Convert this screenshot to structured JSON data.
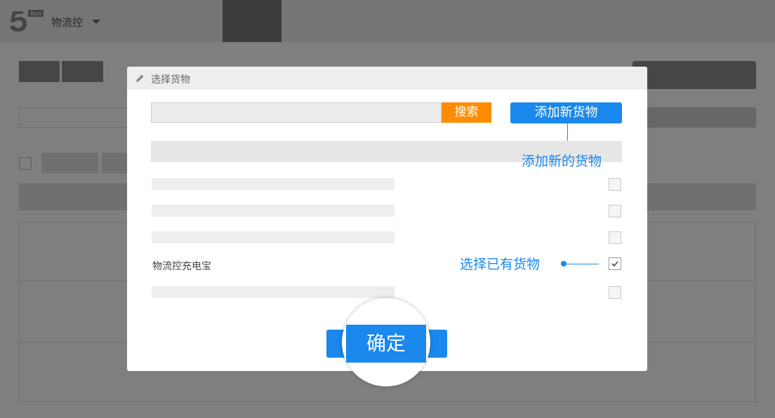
{
  "app": {
    "brand_name": "物流控",
    "logo_badge": "Kon"
  },
  "dialog": {
    "title": "选择货物",
    "search": {
      "placeholder": "",
      "value": "",
      "button_label": "搜索"
    },
    "add_button_label": "添加新货物",
    "items": [
      {
        "name": "",
        "checked": false
      },
      {
        "name": "",
        "checked": false
      },
      {
        "name": "",
        "checked": false
      },
      {
        "name": "物流控充电宝",
        "checked": true
      },
      {
        "name": "",
        "checked": false
      }
    ],
    "confirm_label": "确定"
  },
  "annotations": {
    "add_new": "添加新的货物",
    "select_existing": "选择已有货物"
  },
  "colors": {
    "accent": "#1a88ec",
    "search_button": "#ff8c00",
    "overlay": "rgba(0,0,0,0.5)"
  },
  "icons": {
    "header_icon": "pencil-icon",
    "brand_caret": "chevron-down-icon",
    "checked_mark": "check-icon"
  }
}
